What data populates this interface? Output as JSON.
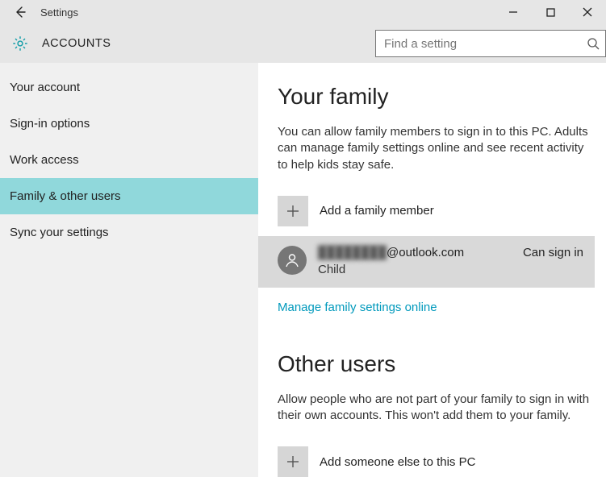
{
  "window": {
    "title": "Settings"
  },
  "header": {
    "section": "ACCOUNTS",
    "search_placeholder": "Find a setting"
  },
  "sidebar": {
    "items": [
      {
        "label": "Your account",
        "selected": false
      },
      {
        "label": "Sign-in options",
        "selected": false
      },
      {
        "label": "Work access",
        "selected": false
      },
      {
        "label": "Family & other users",
        "selected": true
      },
      {
        "label": "Sync your settings",
        "selected": false
      }
    ]
  },
  "main": {
    "family": {
      "heading": "Your family",
      "description": "You can allow family members to sign in to this PC. Adults can manage family settings online and see recent activity to help kids stay safe.",
      "add_label": "Add a family member",
      "member": {
        "email_obscured": "████████",
        "email_suffix": "@outlook.com",
        "role": "Child",
        "status": "Can sign in"
      },
      "manage_link": "Manage family settings online"
    },
    "others": {
      "heading": "Other users",
      "description": "Allow people who are not part of your family to sign in with their own accounts. This won't add them to your family.",
      "add_label": "Add someone else to this PC"
    }
  }
}
